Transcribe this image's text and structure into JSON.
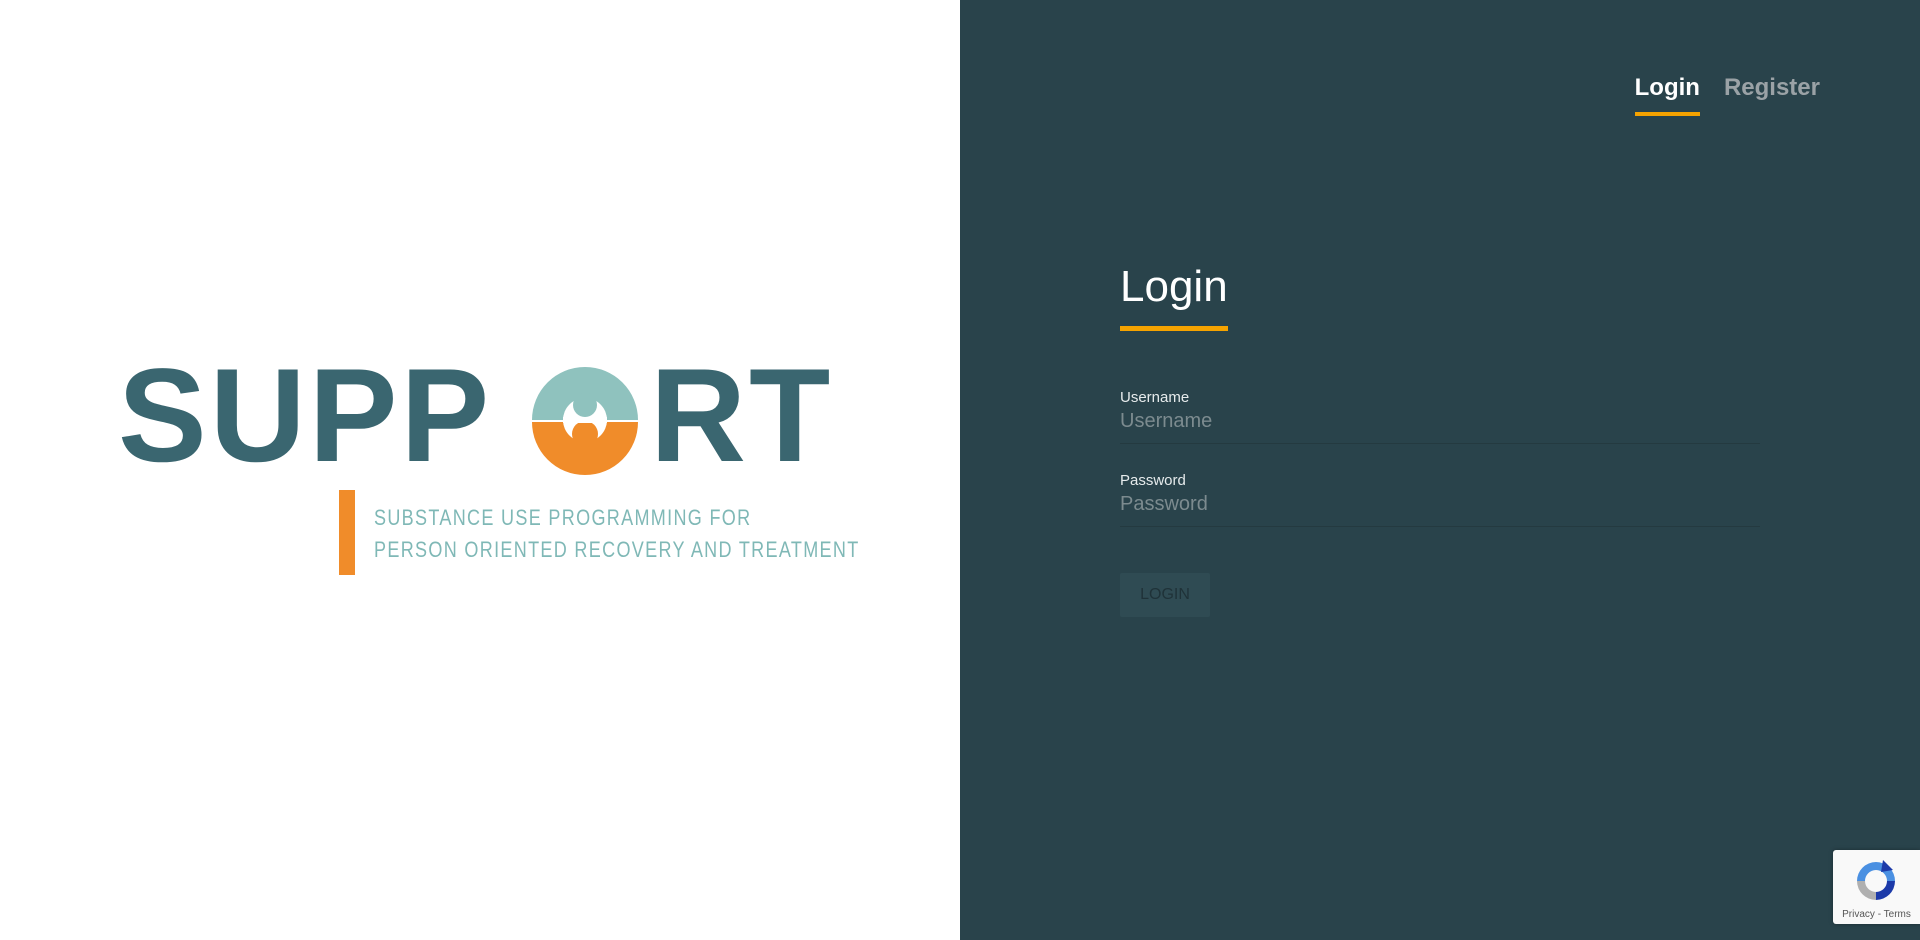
{
  "logo": {
    "word_left": "SUPP",
    "word_right": "RT",
    "tagline_line1": "SUBSTANCE USE PROGRAMMING FOR",
    "tagline_line2": "PERSON ORIENTED RECOVERY AND TREATMENT"
  },
  "nav": {
    "tabs": [
      {
        "label": "Login",
        "active": true
      },
      {
        "label": "Register",
        "active": false
      }
    ]
  },
  "form": {
    "title": "Login",
    "username": {
      "label": "Username",
      "placeholder": "Username",
      "value": ""
    },
    "password": {
      "label": "Password",
      "placeholder": "Password",
      "value": ""
    },
    "submit_label": "LOGIN"
  },
  "recaptcha": {
    "privacy_label": "Privacy",
    "separator": "-",
    "terms_label": "Terms"
  },
  "colors": {
    "panel_bg": "#29434b",
    "accent": "#f5a300",
    "logo_teal": "#3a6670",
    "logo_orange": "#f08c2a",
    "logo_light_teal": "#7fb8b6"
  }
}
